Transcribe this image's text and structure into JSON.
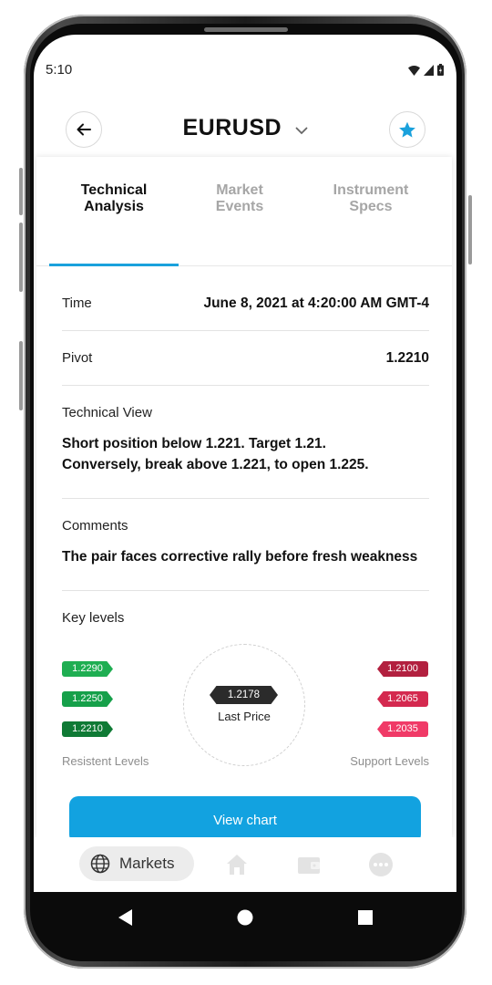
{
  "status_bar": {
    "time": "5:10"
  },
  "header": {
    "title": "EURUSD"
  },
  "tabs": [
    {
      "label_line1": "Technical",
      "label_line2": "Analysis",
      "active": true
    },
    {
      "label_line1": "Market",
      "label_line2": "Events",
      "active": false
    },
    {
      "label_line1": "Instrument",
      "label_line2": "Specs",
      "active": false
    }
  ],
  "details": {
    "time_label": "Time",
    "time_value": "June 8, 2021 at 4:20:00 AM GMT-4",
    "pivot_label": "Pivot",
    "pivot_value": "1.2210",
    "technical_view_label": "Technical View",
    "technical_view_text": "Short position below 1.221. Target 1.21. Conversely, break above 1.221, to open 1.225.",
    "comments_label": "Comments",
    "comments_text": "The pair faces corrective rally before fresh weakness",
    "key_levels_label": "Key levels"
  },
  "key_levels": {
    "resistance": [
      {
        "value": "1.2290",
        "color": "#1fae52"
      },
      {
        "value": "1.2250",
        "color": "#16a04a"
      },
      {
        "value": "1.2210",
        "color": "#0f7a35"
      }
    ],
    "support": [
      {
        "value": "1.2100",
        "color": "#b2203f"
      },
      {
        "value": "1.2065",
        "color": "#d4294f"
      },
      {
        "value": "1.2035",
        "color": "#f03a67"
      }
    ],
    "last_price": "1.2178",
    "last_price_label": "Last Price",
    "resistance_caption": "Resistent Levels",
    "support_caption": "Support Levels"
  },
  "view_chart_label": "View chart",
  "bottom_nav": {
    "markets_label": "Markets"
  },
  "colors": {
    "accent": "#12a2e0",
    "tab_active": "#1aa1dc"
  }
}
